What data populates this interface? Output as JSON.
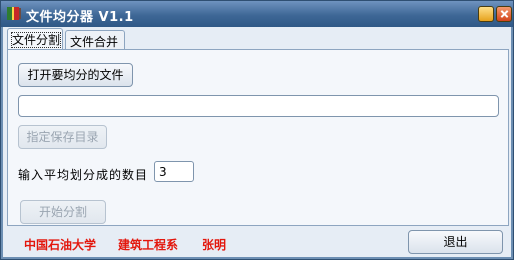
{
  "window": {
    "title": "文件均分器 V1.1"
  },
  "tabs": [
    {
      "label": "文件分割",
      "active": true
    },
    {
      "label": "文件合并",
      "active": false
    }
  ],
  "split_panel": {
    "open_button_label": "打开要均分的文件",
    "path_value": "",
    "dir_button_label": "指定保存目录",
    "count_label": "输入平均划分成的数目",
    "count_value": "3",
    "start_button_label": "开始分割"
  },
  "footer": {
    "credits": [
      "中国石油大学",
      "建筑工程系",
      "张明"
    ],
    "exit_label": "退出"
  },
  "colors": {
    "titlebar": "#3e6796",
    "credits_red": "#e3170d",
    "panel_bg": "#f4f7fb"
  },
  "icons": {
    "app": "book-icon",
    "minimize": "minimize-icon",
    "close": "close-icon"
  }
}
